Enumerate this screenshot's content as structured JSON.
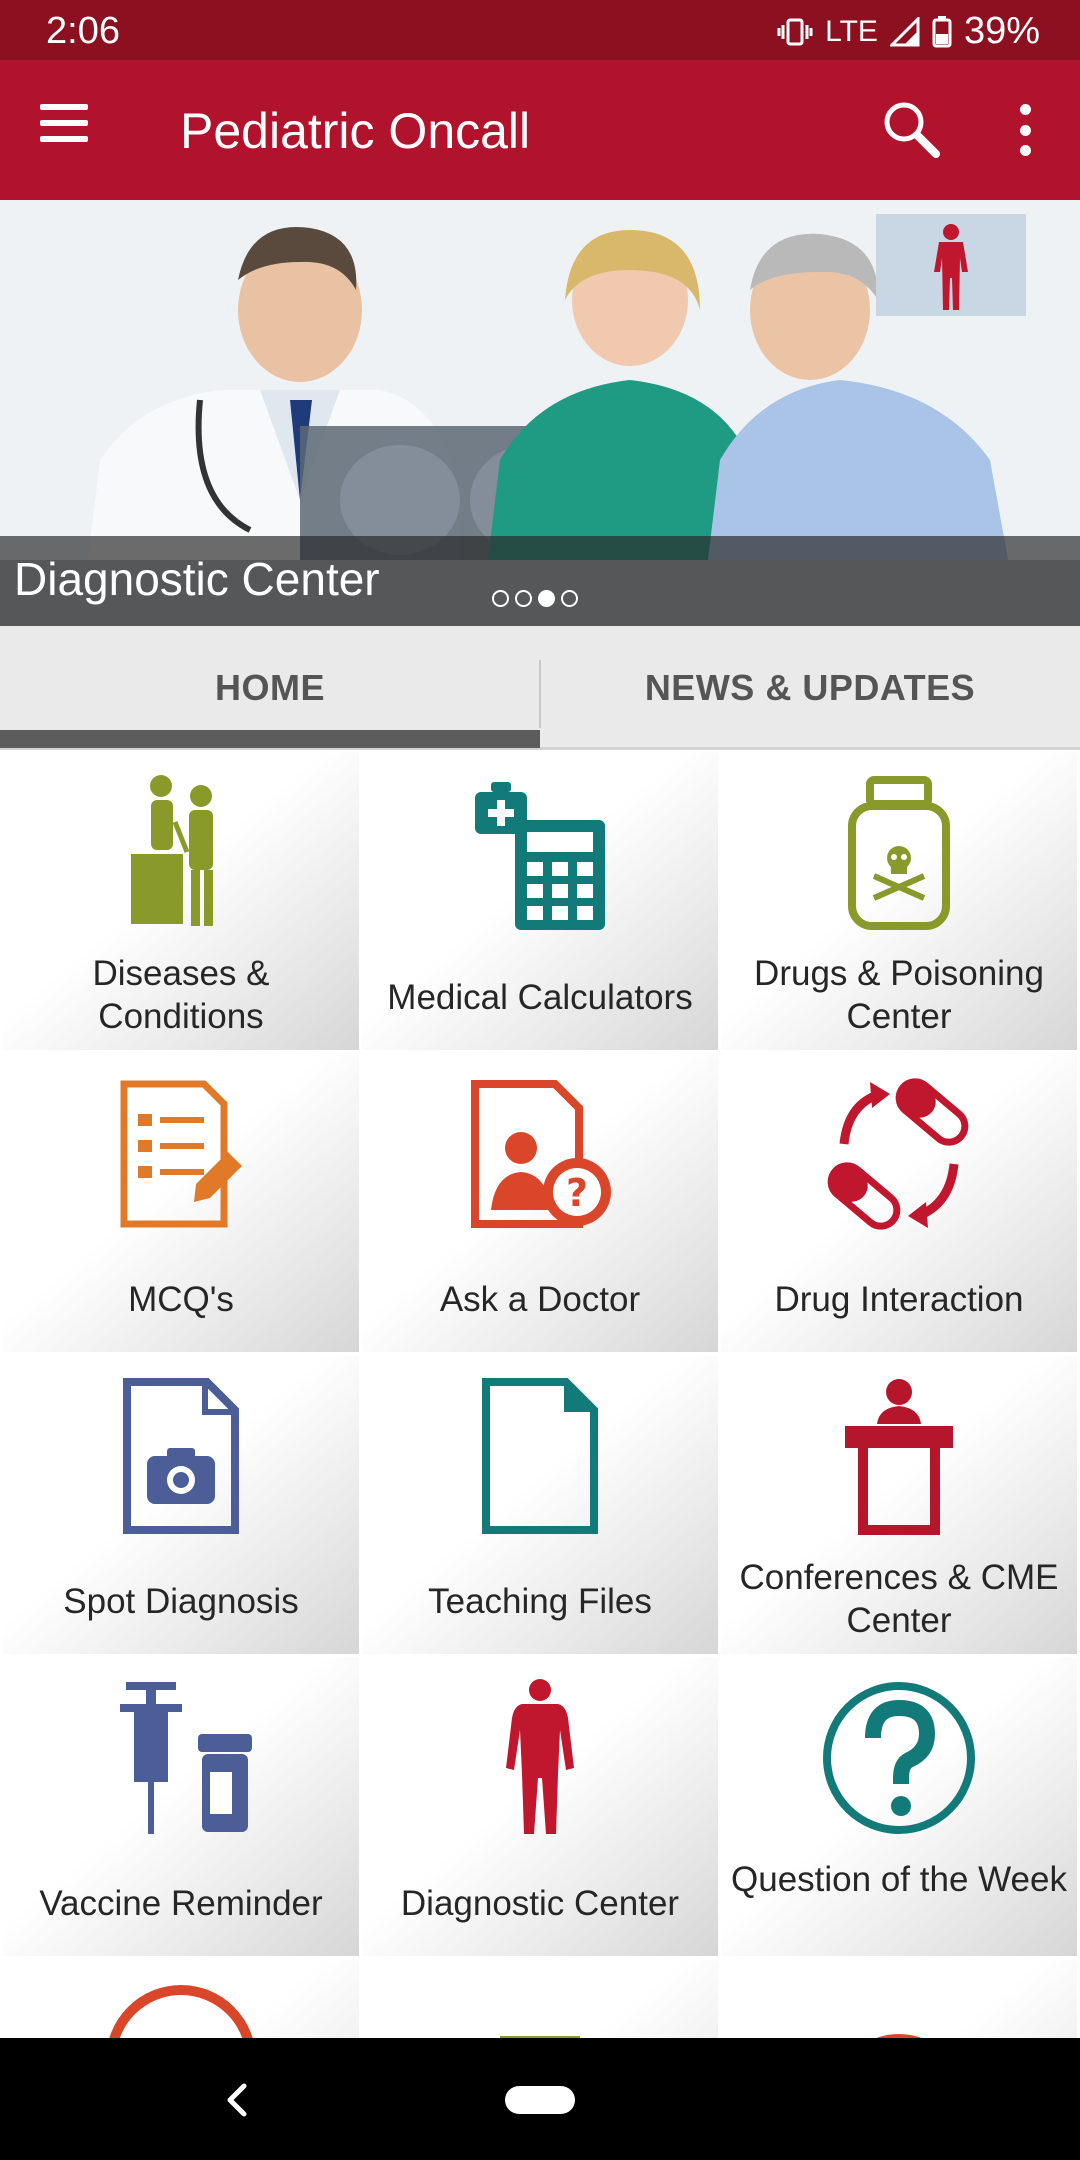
{
  "status_bar": {
    "time": "2:06",
    "network": "LTE",
    "battery": "39%"
  },
  "app_bar": {
    "title": "Pediatric Oncall",
    "menu_icon": "hamburger-menu-icon",
    "search_icon": "search-icon",
    "overflow_icon": "more-vert-icon"
  },
  "banner": {
    "caption": "Diagnostic Center",
    "slide_count": 4,
    "active_slide": 3
  },
  "tabs": [
    {
      "label": "HOME",
      "active": true
    },
    {
      "label": "NEWS & UPDATES",
      "active": false
    }
  ],
  "grid": {
    "items": [
      {
        "label": "Diseases & Conditions",
        "icon": "doctor-patient-icon",
        "color": "#8a9a2a"
      },
      {
        "label": "Medical Calculators",
        "icon": "calculator-icon",
        "color": "#137a7a"
      },
      {
        "label": "Drugs & Poisoning Center",
        "icon": "poison-bottle-icon",
        "color": "#8a9a2a"
      },
      {
        "label": "MCQ's",
        "icon": "checklist-icon",
        "color": "#e07a28"
      },
      {
        "label": "Ask a Doctor",
        "icon": "ask-doctor-icon",
        "color": "#d9462a"
      },
      {
        "label": "Drug Interaction",
        "icon": "drug-interaction-icon",
        "color": "#c0172f"
      },
      {
        "label": "Spot Diagnosis",
        "icon": "camera-file-icon",
        "color": "#4b5e98"
      },
      {
        "label": "Teaching Files",
        "icon": "document-icon",
        "color": "#137a7a"
      },
      {
        "label": "Conferences & CME Center",
        "icon": "podium-speaker-icon",
        "color": "#b5162b"
      },
      {
        "label": "Vaccine Reminder",
        "icon": "syringe-vial-icon",
        "color": "#4b5e98"
      },
      {
        "label": "Diagnostic Center",
        "icon": "human-body-icon",
        "color": "#c0172f"
      },
      {
        "label": "Question of the Week",
        "icon": "question-circle-icon",
        "color": "#137a7a"
      }
    ]
  },
  "nav_bar": {
    "back_icon": "back-chevron-icon",
    "home_icon": "home-pill-icon"
  }
}
